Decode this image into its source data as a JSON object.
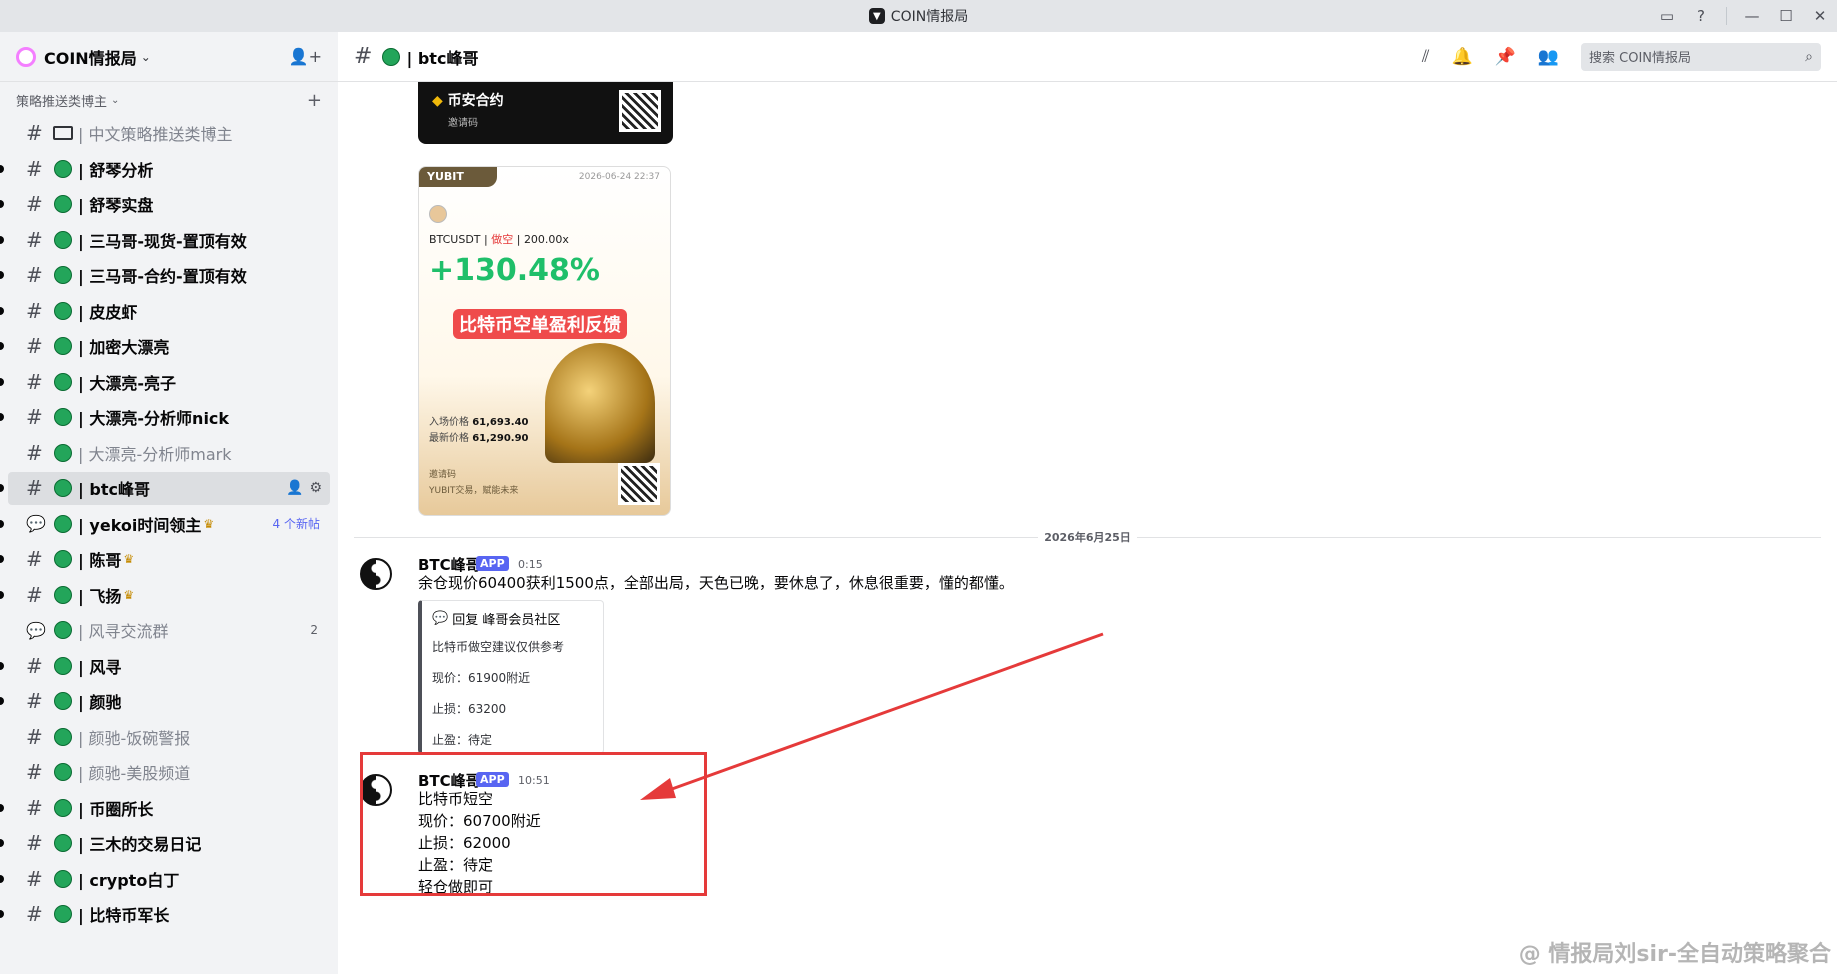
{
  "window": {
    "title": "COIN情报局",
    "logo_icon": "app-logo-icon"
  },
  "sidebar": {
    "server_name": "COIN情报局",
    "category": "策略推送类博主",
    "channels": [
      {
        "name": "| 中文策略推送类博主",
        "type": "screen",
        "unread": false,
        "muted": true
      },
      {
        "name": "| 舒琴分析",
        "type": "text",
        "unread": true,
        "muted": false
      },
      {
        "name": "| 舒琴实盘",
        "type": "text",
        "unread": true,
        "muted": false
      },
      {
        "name": "| 三马哥-现货-置顶有效",
        "type": "text",
        "unread": true,
        "muted": false
      },
      {
        "name": "| 三马哥-合约-置顶有效",
        "type": "text",
        "unread": true,
        "muted": false
      },
      {
        "name": "| 皮皮虾",
        "type": "text",
        "unread": true,
        "muted": false
      },
      {
        "name": "| 加密大漂亮",
        "type": "text",
        "unread": true,
        "muted": false
      },
      {
        "name": "| 大漂亮-亮子",
        "type": "text",
        "unread": true,
        "muted": false
      },
      {
        "name": "| 大漂亮-分析师nick",
        "type": "text",
        "unread": true,
        "muted": false
      },
      {
        "name": "| 大漂亮-分析师mark",
        "type": "text",
        "unread": false,
        "muted": true
      },
      {
        "name": "| btc峰哥",
        "type": "text",
        "unread": true,
        "muted": false,
        "selected": true
      },
      {
        "name": "| yekoi时间领主",
        "type": "forum",
        "unread": true,
        "muted": false,
        "crown": true,
        "badge": "4 个新帖"
      },
      {
        "name": "| 陈哥",
        "type": "text",
        "unread": true,
        "muted": false,
        "crown": true
      },
      {
        "name": "| 飞扬",
        "type": "text",
        "unread": true,
        "muted": false,
        "crown": true
      },
      {
        "name": "| 风寻交流群",
        "type": "forum",
        "unread": false,
        "muted": true,
        "count": "2"
      },
      {
        "name": "| 风寻",
        "type": "text",
        "unread": true,
        "muted": false
      },
      {
        "name": "| 颜驰",
        "type": "text",
        "unread": true,
        "muted": false
      },
      {
        "name": "| 颜驰-饭碗警报",
        "type": "text",
        "unread": false,
        "muted": true
      },
      {
        "name": "| 颜驰-美股频道",
        "type": "text",
        "unread": false,
        "muted": true
      },
      {
        "name": "| 币圈所长",
        "type": "text",
        "unread": true,
        "muted": false
      },
      {
        "name": "| 三木的交易日记",
        "type": "text",
        "unread": true,
        "muted": false
      },
      {
        "name": "| crypto白丁",
        "type": "text",
        "unread": true,
        "muted": false
      },
      {
        "name": "| 比特币军长",
        "type": "text",
        "unread": true,
        "muted": false
      }
    ]
  },
  "header": {
    "channel_title": "| btc峰哥",
    "search_placeholder": "搜索 COIN情报局"
  },
  "images": {
    "binance": {
      "brand": "币安",
      "brand_suffix": "合约",
      "invite": "邀请码"
    },
    "yubit": {
      "tag": "YUBIT",
      "date": "2026-06-24 22:37",
      "pair": "BTCUSDT",
      "side": "做空",
      "leverage": "200.00x",
      "pnl": "+130.48%",
      "banner": "比特币空单盈利反馈",
      "entry_label": "入场价格",
      "entry_value": "61,693.40",
      "latest_label": "最新价格",
      "latest_value": "61,290.90",
      "invite": "邀请码",
      "slogan": "YUBIT交易，赋能未来"
    }
  },
  "date_divider": "2026年6月25日",
  "messages": [
    {
      "author": "BTC峰哥",
      "tag": "APP",
      "time": "0:15",
      "text": "余仓现价60400获利1500点，全部出局，天色已晚，要休息了，休息很重要，懂的都懂。",
      "reply": {
        "title": "回复 峰哥会员社区",
        "lines": [
          "比特币做空建议仅供参考",
          "现价：61900附近",
          "止损：63200",
          "止盈：待定"
        ]
      }
    },
    {
      "author": "BTC峰哥",
      "tag": "APP",
      "time": "10:51",
      "lines": [
        "比特币短空",
        "现价：60700附近",
        "止损：62000",
        "止盈：待定",
        "轻仓做即可"
      ]
    }
  ],
  "watermark": "@ 情报局刘sir-全自动策略聚合",
  "colors": {
    "accent": "#5865f2",
    "online": "#23a55a",
    "highlight": "#e53a3a"
  }
}
